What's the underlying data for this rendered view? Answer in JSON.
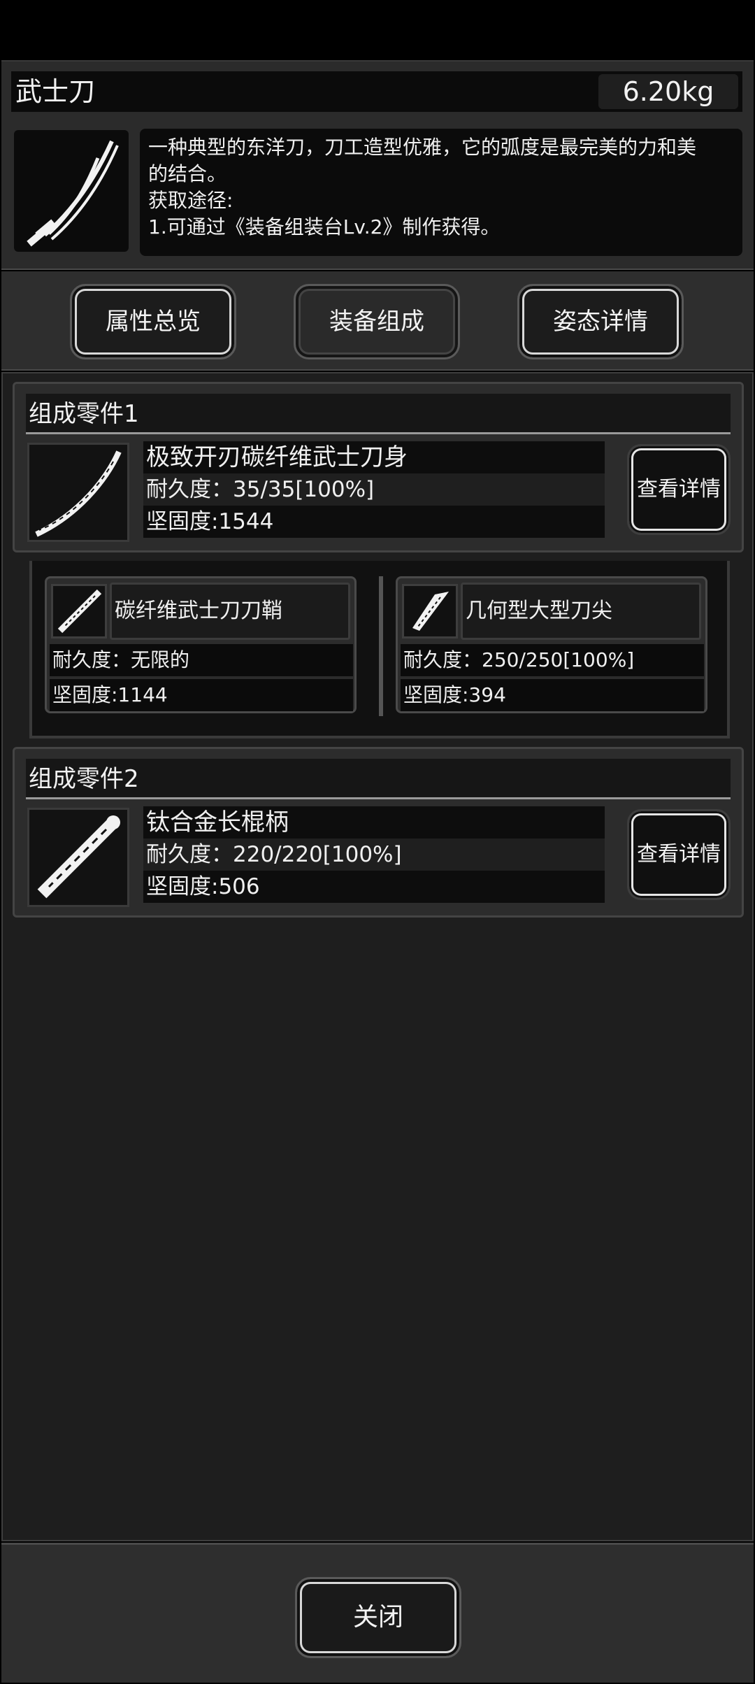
{
  "item": {
    "name": "武士刀",
    "weight": "6.20kg",
    "icon": "katana-icon",
    "description": [
      "一种典型的东洋刀，刀工造型优雅，它的弧度是最完美的力和美",
      "的结合。",
      "获取途径:",
      "1.可通过《装备组装台Lv.2》制作获得。"
    ]
  },
  "tabs": [
    {
      "label": "属性总览",
      "active": false
    },
    {
      "label": "装备组成",
      "active": true
    },
    {
      "label": "姿态详情",
      "active": false
    }
  ],
  "parts": [
    {
      "header": "组成零件1",
      "icon": "blade-icon",
      "name": "极致开刃碳纤维武士刀身",
      "durability": "耐久度：35/35[100%]",
      "hardness": "坚固度:1544",
      "detail_label": "查看详情",
      "subparts": [
        {
          "icon": "scabbard-icon",
          "name": "碳纤维武士刀刀鞘",
          "durability": "耐久度：无限的",
          "hardness": "坚固度:1144"
        },
        {
          "icon": "blade-tip-icon",
          "name": "几何型大型刀尖",
          "durability": "耐久度：250/250[100%]",
          "hardness": "坚固度:394"
        }
      ]
    },
    {
      "header": "组成零件2",
      "icon": "hilt-icon",
      "name": "钛合金长棍柄",
      "durability": "耐久度：220/220[100%]",
      "hardness": "坚固度:506",
      "detail_label": "查看详情"
    }
  ],
  "footer": {
    "close_label": "关闭"
  }
}
